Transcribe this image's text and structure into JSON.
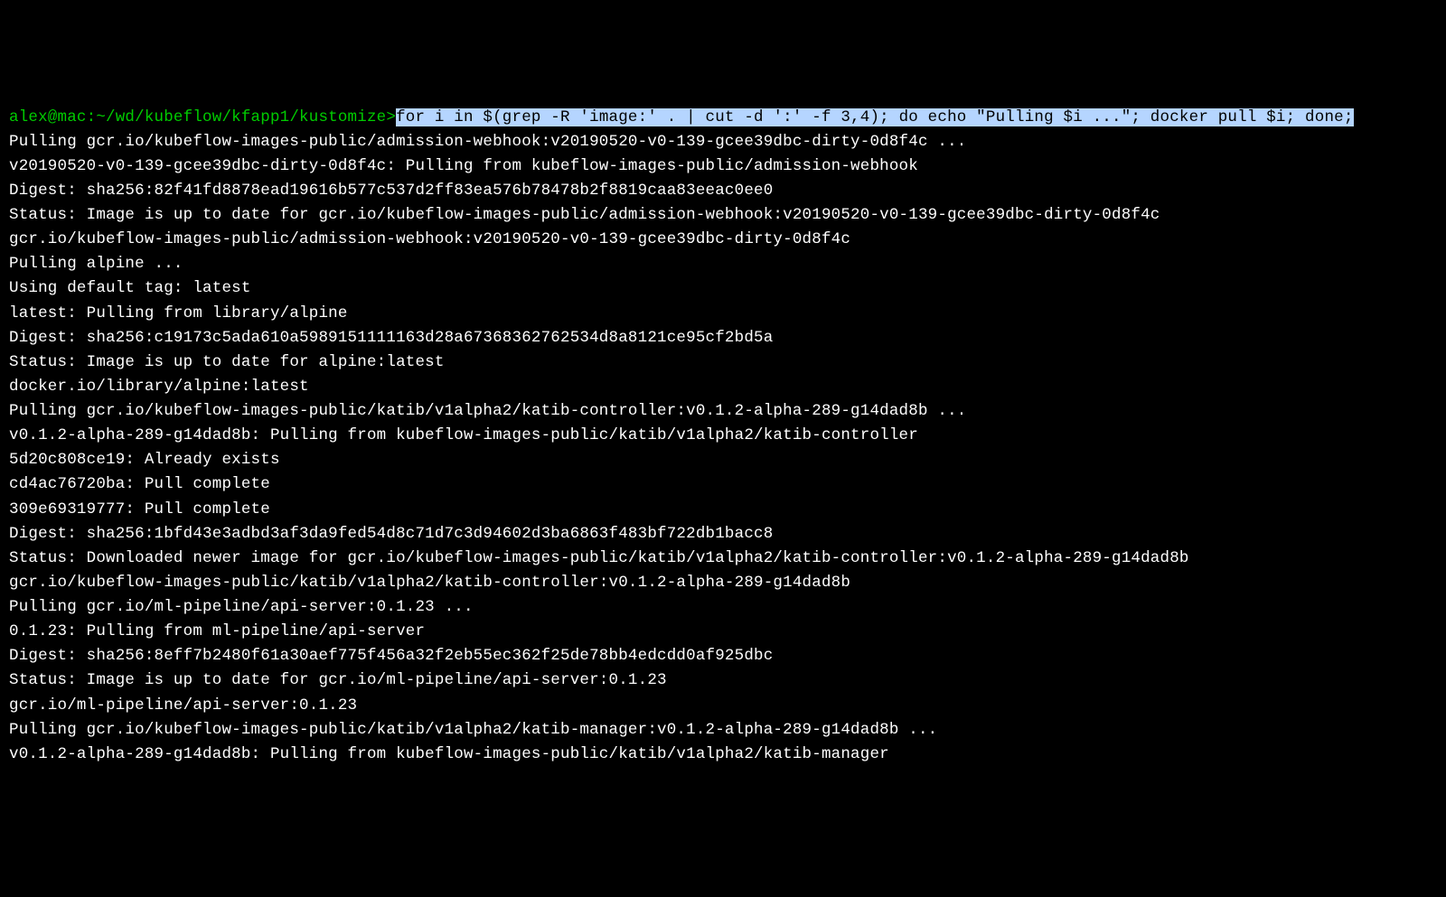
{
  "terminal": {
    "prompt": "alex@mac:~/wd/kubeflow/kfapp1/kustomize>",
    "command": "for i in $(grep -R 'image:' . | cut -d ':' -f 3,4); do echo \"Pulling $i ...\"; docker pull $i; done;",
    "lines": [
      "Pulling gcr.io/kubeflow-images-public/admission-webhook:v20190520-v0-139-gcee39dbc-dirty-0d8f4c ...",
      "v20190520-v0-139-gcee39dbc-dirty-0d8f4c: Pulling from kubeflow-images-public/admission-webhook",
      "Digest: sha256:82f41fd8878ead19616b577c537d2ff83ea576b78478b2f8819caa83eeac0ee0",
      "Status: Image is up to date for gcr.io/kubeflow-images-public/admission-webhook:v20190520-v0-139-gcee39dbc-dirty-0d8f4c",
      "gcr.io/kubeflow-images-public/admission-webhook:v20190520-v0-139-gcee39dbc-dirty-0d8f4c",
      "Pulling alpine ...",
      "Using default tag: latest",
      "latest: Pulling from library/alpine",
      "Digest: sha256:c19173c5ada610a5989151111163d28a67368362762534d8a8121ce95cf2bd5a",
      "Status: Image is up to date for alpine:latest",
      "docker.io/library/alpine:latest",
      "Pulling gcr.io/kubeflow-images-public/katib/v1alpha2/katib-controller:v0.1.2-alpha-289-g14dad8b ...",
      "v0.1.2-alpha-289-g14dad8b: Pulling from kubeflow-images-public/katib/v1alpha2/katib-controller",
      "5d20c808ce19: Already exists",
      "cd4ac76720ba: Pull complete",
      "309e69319777: Pull complete",
      "Digest: sha256:1bfd43e3adbd3af3da9fed54d8c71d7c3d94602d3ba6863f483bf722db1bacc8",
      "Status: Downloaded newer image for gcr.io/kubeflow-images-public/katib/v1alpha2/katib-controller:v0.1.2-alpha-289-g14dad8b",
      "gcr.io/kubeflow-images-public/katib/v1alpha2/katib-controller:v0.1.2-alpha-289-g14dad8b",
      "Pulling gcr.io/ml-pipeline/api-server:0.1.23 ...",
      "0.1.23: Pulling from ml-pipeline/api-server",
      "Digest: sha256:8eff7b2480f61a30aef775f456a32f2eb55ec362f25de78bb4edcdd0af925dbc",
      "Status: Image is up to date for gcr.io/ml-pipeline/api-server:0.1.23",
      "gcr.io/ml-pipeline/api-server:0.1.23",
      "Pulling gcr.io/kubeflow-images-public/katib/v1alpha2/katib-manager:v0.1.2-alpha-289-g14dad8b ...",
      "v0.1.2-alpha-289-g14dad8b: Pulling from kubeflow-images-public/katib/v1alpha2/katib-manager"
    ]
  }
}
